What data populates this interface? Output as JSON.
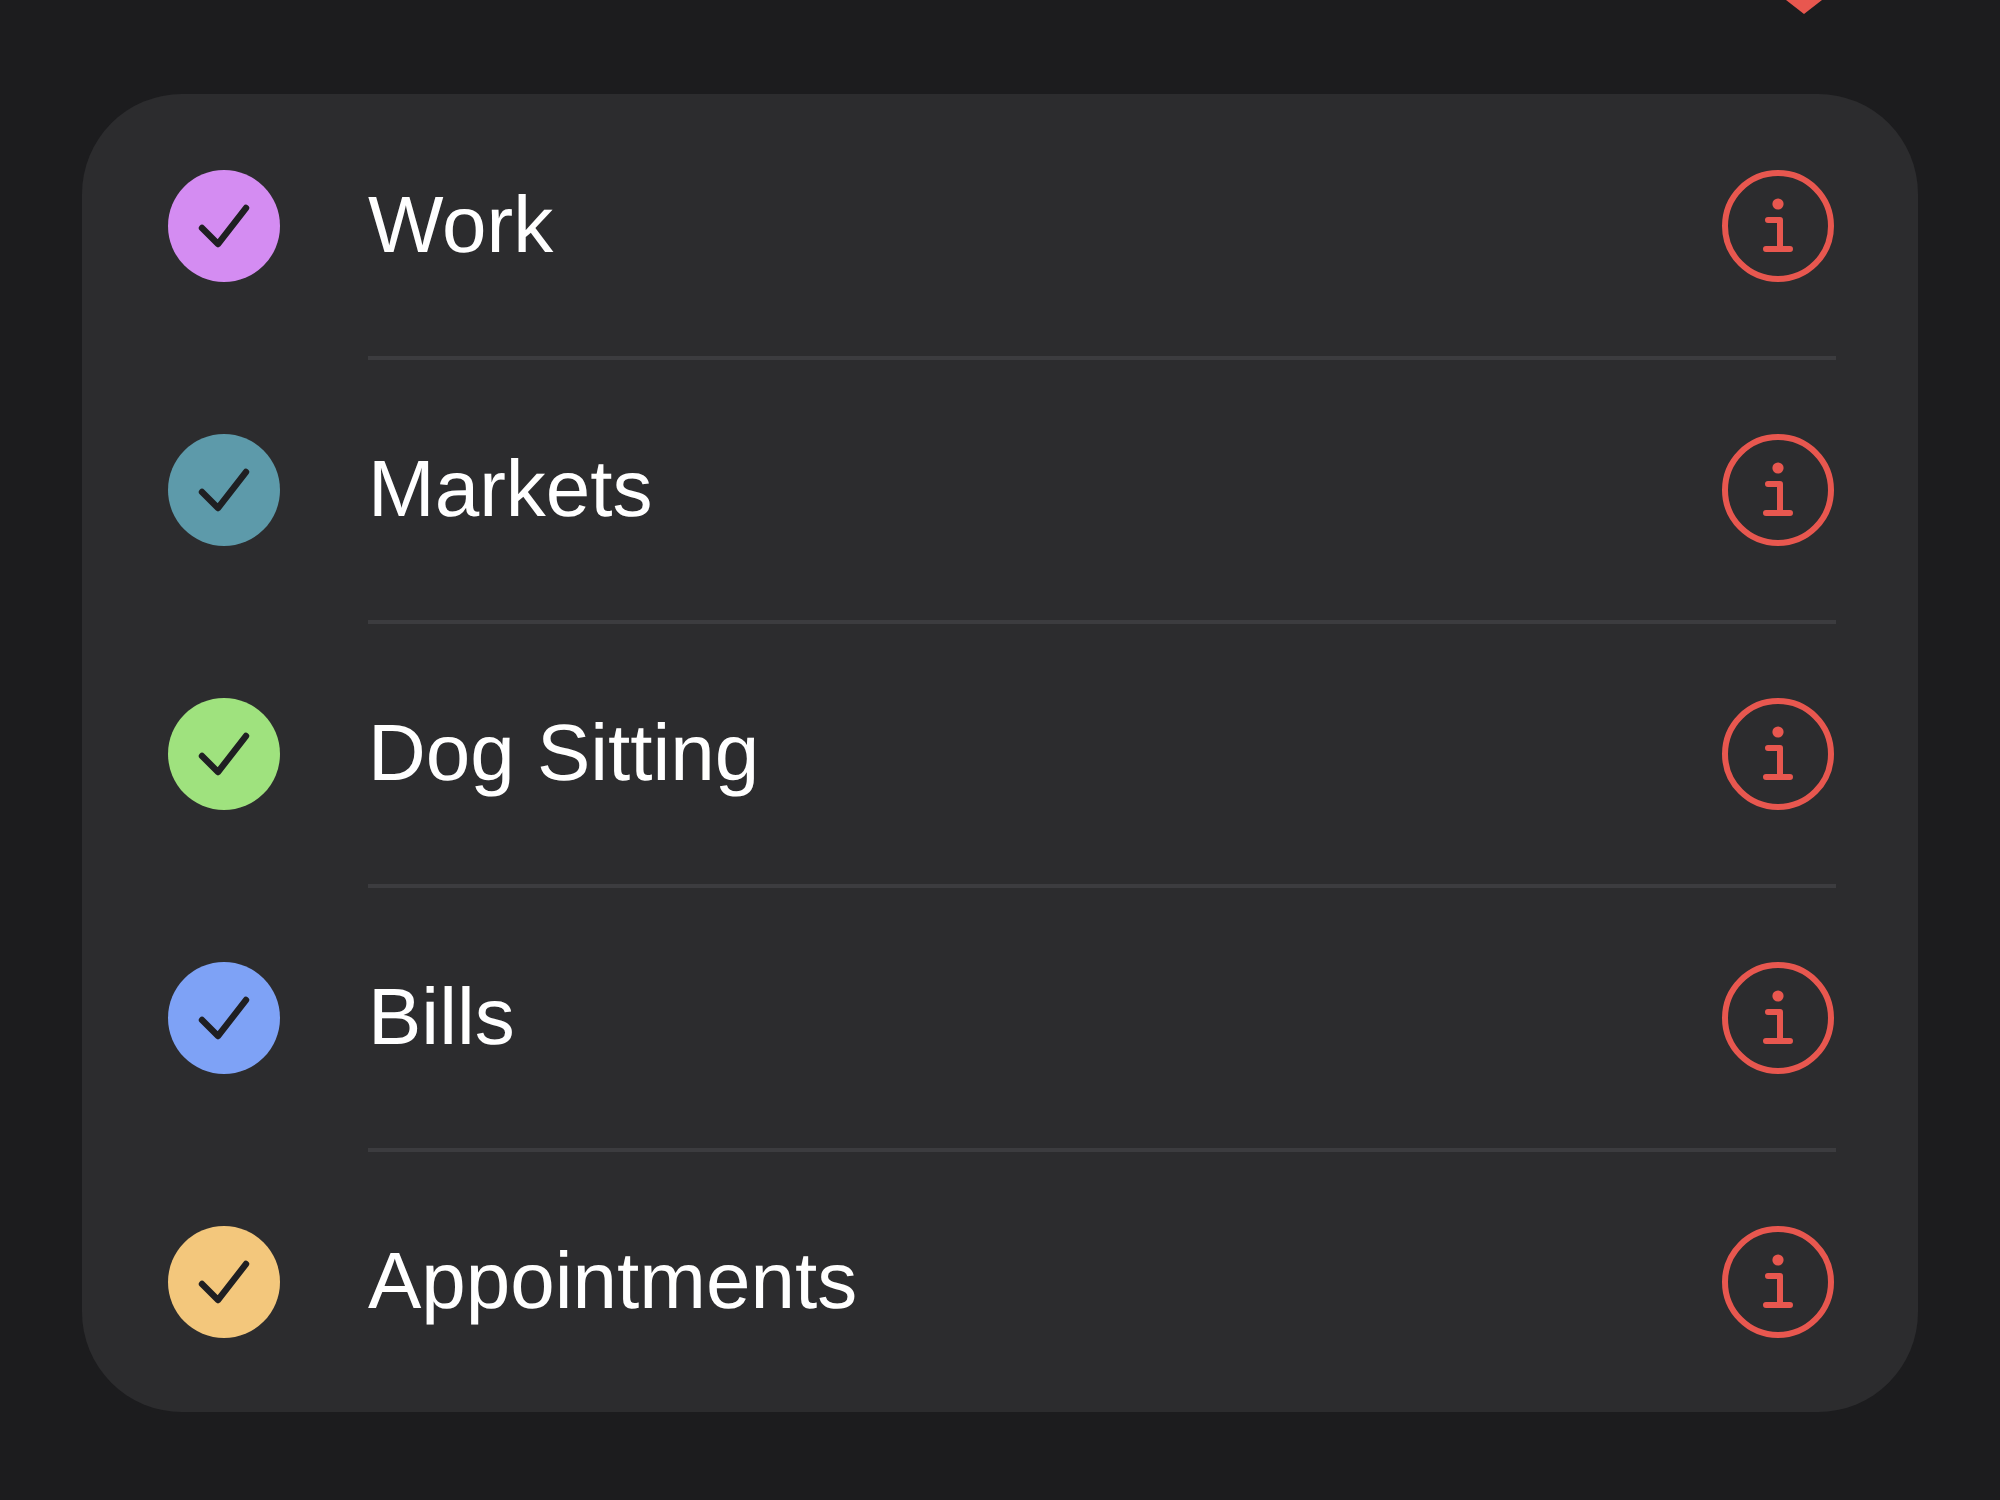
{
  "lists": [
    {
      "name": "Work",
      "checked": true,
      "color": "#d48cf2"
    },
    {
      "name": "Markets",
      "checked": true,
      "color": "#5d9aaa"
    },
    {
      "name": "Dog Sitting",
      "checked": true,
      "color": "#9fe27e"
    },
    {
      "name": "Bills",
      "checked": true,
      "color": "#7ea2f6"
    },
    {
      "name": "Appointments",
      "checked": true,
      "color": "#f3c77c"
    }
  ]
}
